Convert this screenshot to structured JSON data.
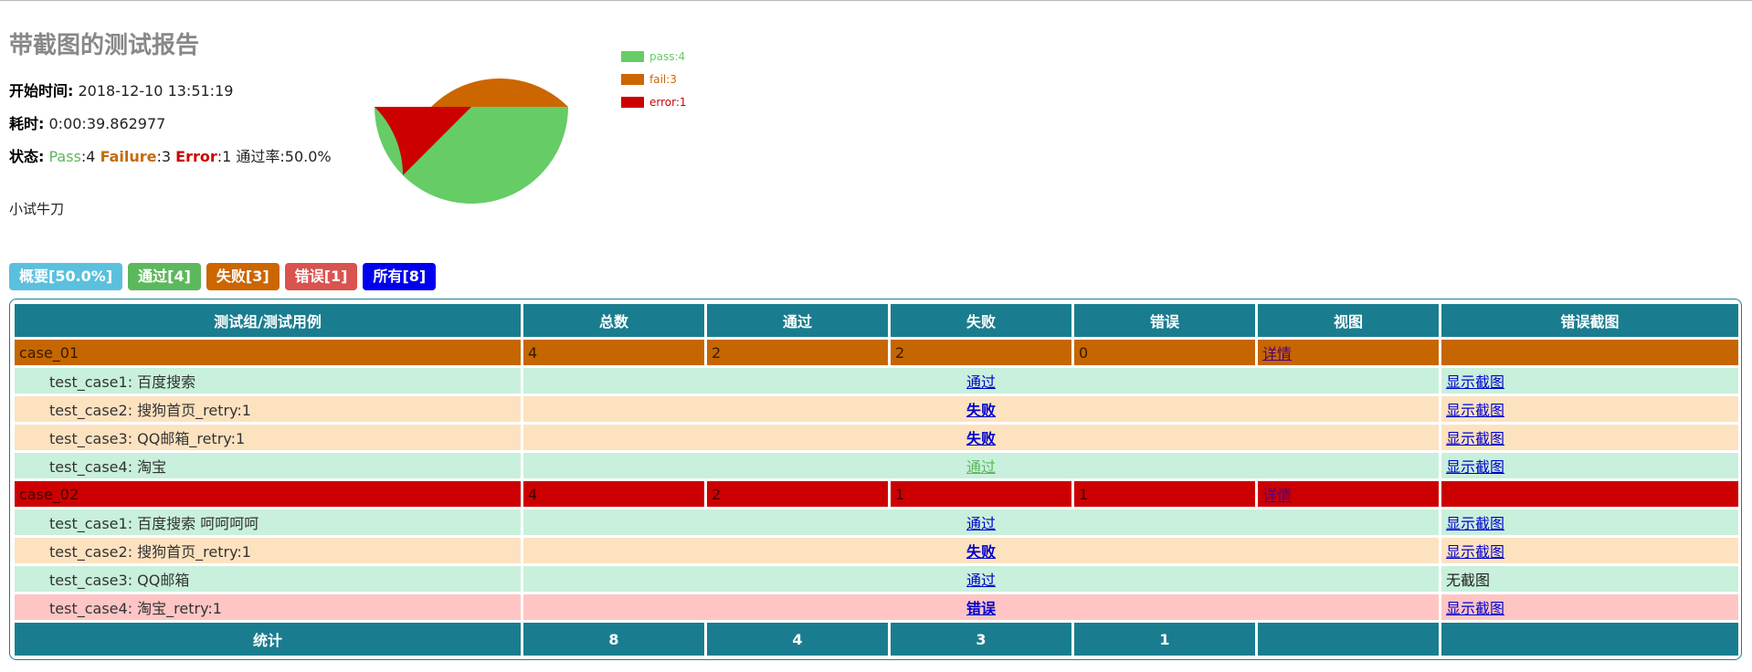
{
  "report": {
    "title": "带截图的测试报告",
    "start_label": "开始时间:",
    "start_value": "2018-12-10 13:51:19",
    "duration_label": "耗时:",
    "duration_value": "0:00:39.862977",
    "status_label": "状态:",
    "pass_label": "Pass",
    "pass_value": ":4",
    "failure_label": "Failure",
    "failure_value": ":3",
    "error_label": "Error",
    "error_value": ":1",
    "rate": "通过率:50.0%",
    "description": "小试牛刀"
  },
  "chart_data": {
    "type": "pie",
    "slices": [
      {
        "name": "pass:4",
        "value": 4,
        "color": "#66cc66"
      },
      {
        "name": "fail:3",
        "value": 3,
        "color": "#cc6600"
      },
      {
        "name": "error:1",
        "value": 1,
        "color": "#cc0000"
      }
    ],
    "legend_placement": "right"
  },
  "filters": [
    {
      "label": "概要[50.0%]",
      "color": "#5bc0de"
    },
    {
      "label": "通过[4]",
      "color": "#5cb85c"
    },
    {
      "label": "失败[3]",
      "color": "#cc6600"
    },
    {
      "label": "错误[1]",
      "color": "#d9534f"
    },
    {
      "label": "所有[8]",
      "color": "#0000ee"
    }
  ],
  "table": {
    "headers": [
      "测试组/测试用例",
      "总数",
      "通过",
      "失败",
      "错误",
      "视图",
      "错误截图"
    ],
    "groups": [
      {
        "name": "case_01",
        "total": "4",
        "pass": "2",
        "fail": "2",
        "error": "0",
        "detail": "详情",
        "kind": "fail",
        "cases": [
          {
            "name": "test_case1: 百度搜索",
            "status": "通过",
            "kind": "pass",
            "shot": "显示截图"
          },
          {
            "name": "test_case2: 搜狗首页_retry:1",
            "status": "失败",
            "kind": "fail",
            "shot": "显示截图"
          },
          {
            "name": "test_case3: QQ邮箱_retry:1",
            "status": "失败",
            "kind": "fail",
            "shot": "显示截图"
          },
          {
            "name": "test_case4: 淘宝",
            "status": "通过",
            "kind": "pass-green",
            "shot": "显示截图"
          }
        ]
      },
      {
        "name": "case_02",
        "total": "4",
        "pass": "2",
        "fail": "1",
        "error": "1",
        "detail": "详情",
        "kind": "error",
        "cases": [
          {
            "name": "test_case1: 百度搜索 呵呵呵呵",
            "status": "通过",
            "kind": "pass",
            "shot": "显示截图"
          },
          {
            "name": "test_case2: 搜狗首页_retry:1",
            "status": "失败",
            "kind": "fail",
            "shot": "显示截图"
          },
          {
            "name": "test_case3: QQ邮箱",
            "status": "通过",
            "kind": "pass",
            "shot": "无截图",
            "noshot": true
          },
          {
            "name": "test_case4: 淘宝_retry:1",
            "status": "错误",
            "kind": "error",
            "shot": "显示截图"
          }
        ]
      }
    ],
    "total": {
      "label": "统计",
      "total": "8",
      "pass": "4",
      "fail": "3",
      "error": "1"
    }
  }
}
